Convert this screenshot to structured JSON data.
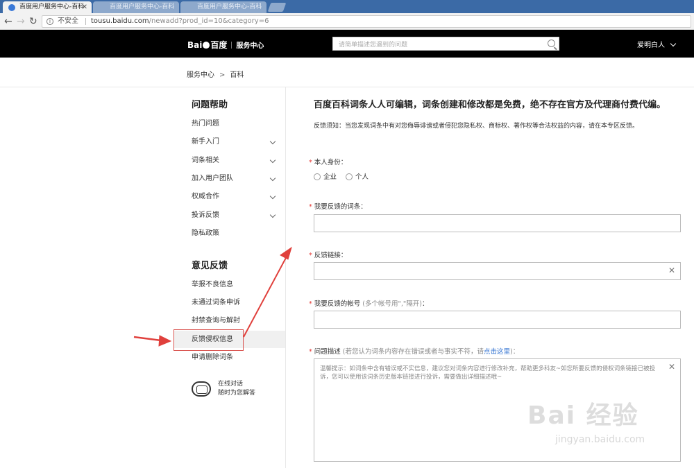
{
  "browser": {
    "tabs": [
      {
        "title": "百度用户服务中心-百科"
      },
      {
        "title": "百度用户服务中心-百科"
      },
      {
        "title": "百度用户服务中心-百科"
      }
    ],
    "address": {
      "security_label": "不安全",
      "host": "tousu.baidu.com",
      "path": "/newadd?prod_id=10&category=6"
    }
  },
  "header": {
    "logo_text_left": "Bai",
    "logo_text_right": "百度",
    "service_label": "服务中心",
    "search_placeholder": "请简单描述您遇到的问题",
    "user_name": "爱明白人"
  },
  "breadcrumb": {
    "items": [
      "服务中心",
      "百科"
    ],
    "separator": ">"
  },
  "sidebar": {
    "help_title": "问题帮助",
    "help_items": [
      {
        "label": "热门问题",
        "expandable": false
      },
      {
        "label": "新手入门",
        "expandable": true
      },
      {
        "label": "词条相关",
        "expandable": true
      },
      {
        "label": "加入用户团队",
        "expandable": true
      },
      {
        "label": "权威合作",
        "expandable": true
      },
      {
        "label": "投诉反馈",
        "expandable": true
      },
      {
        "label": "隐私政策",
        "expandable": false
      }
    ],
    "feedback_title": "意见反馈",
    "feedback_items": [
      {
        "label": "举报不良信息"
      },
      {
        "label": "未通过词条申诉"
      },
      {
        "label": "封禁查询与解封"
      },
      {
        "label": "反馈侵权信息"
      },
      {
        "label": "申请删除词条"
      }
    ],
    "support_line1": "在线对话",
    "support_line2": "随时为您解答"
  },
  "main": {
    "title": "百度百科词条人人可编辑，词条创建和修改都是免费，绝不存在官方及代理商付费代编。",
    "notice": "反馈须知：当您发现词条中有对您侮辱诽谤或者侵犯您隐私权、商标权、著作权等合法权益的内容，请在本专区反馈。",
    "identity_label": "本人身份：",
    "identity_options": [
      "企业",
      "个人"
    ],
    "entry_label": "我要反馈的词条：",
    "link_label": "反馈链接：",
    "account_label": "我要反馈的帐号",
    "account_hint": "(多个帐号用\",\"隔开)",
    "account_colon": "：",
    "desc_label": "问题描述",
    "desc_hint": "(若您认为词条内容存在错误或者与事实不符，请",
    "desc_link": "点击这里",
    "desc_hint_end": ")：",
    "desc_placeholder": "温馨提示：如词条中含有错误或不实信息，建议您对词条内容进行修改补充，帮助更多科友~如您所要反馈的侵权词条链接已被投诉，您可以使用该词条历史版本链接进行投诉，需要做出详细描述哦~"
  },
  "watermark": {
    "brand": "Bai  经验",
    "site": "jingyan.baidu.com"
  },
  "colors": {
    "header_bg": "#000000",
    "accent_link": "#2d6fd0",
    "required": "#e53935",
    "annotation": "#d9534f"
  }
}
